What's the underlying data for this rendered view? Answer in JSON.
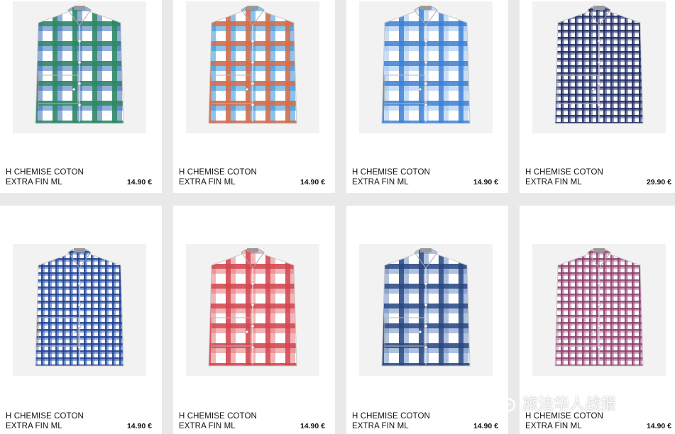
{
  "products": [
    {
      "name_line1": "H CHEMISE COTON",
      "name_line2": "EXTRA FIN ML",
      "price": "14.90 €",
      "pattern": "green-white-plaid",
      "colors": [
        "#2c8a5e",
        "#3a6fb5",
        "#ffffff"
      ]
    },
    {
      "name_line1": "H CHEMISE COTON",
      "name_line2": "EXTRA FIN ML",
      "price": "14.90 €",
      "pattern": "orange-blue-plaid",
      "colors": [
        "#e26a3f",
        "#2f8fd6",
        "#ffffff"
      ]
    },
    {
      "name_line1": "H CHEMISE COTON",
      "name_line2": "EXTRA FIN ML",
      "price": "14.90 €",
      "pattern": "blue-white-plaid",
      "colors": [
        "#3b7fd4",
        "#9cc3ee",
        "#ffffff"
      ]
    },
    {
      "name_line1": "H CHEMISE COTON",
      "name_line2": "EXTRA FIN ML",
      "price": "29.90 €",
      "pattern": "navy-gingham",
      "colors": [
        "#1f2a5c",
        "#3a4a86",
        "#ffffff"
      ]
    },
    {
      "name_line1": "H CHEMISE COTON",
      "name_line2": "EXTRA FIN ML",
      "price": "14.90 €",
      "pattern": "blue-gingham",
      "colors": [
        "#1d3f8f",
        "#3f66b8",
        "#ffffff"
      ]
    },
    {
      "name_line1": "H CHEMISE COTON",
      "name_line2": "EXTRA FIN ML",
      "price": "14.90 €",
      "pattern": "red-check",
      "colors": [
        "#d2454f",
        "#e77a80",
        "#ffffff"
      ]
    },
    {
      "name_line1": "H CHEMISE COTON",
      "name_line2": "EXTRA FIN ML",
      "price": "14.90 €",
      "pattern": "navy-blue-plaid",
      "colors": [
        "#27457e",
        "#6d8fc4",
        "#ffffff"
      ]
    },
    {
      "name_line1": "H CHEMISE COTON",
      "name_line2": "EXTRA FIN ML",
      "price": "14.90 €",
      "pattern": "purple-check",
      "colors": [
        "#8a3e6a",
        "#b56f98",
        "#ffffff"
      ]
    }
  ],
  "watermark": {
    "text": "旅法华人战报",
    "icon": "wechat-logo-icon"
  }
}
